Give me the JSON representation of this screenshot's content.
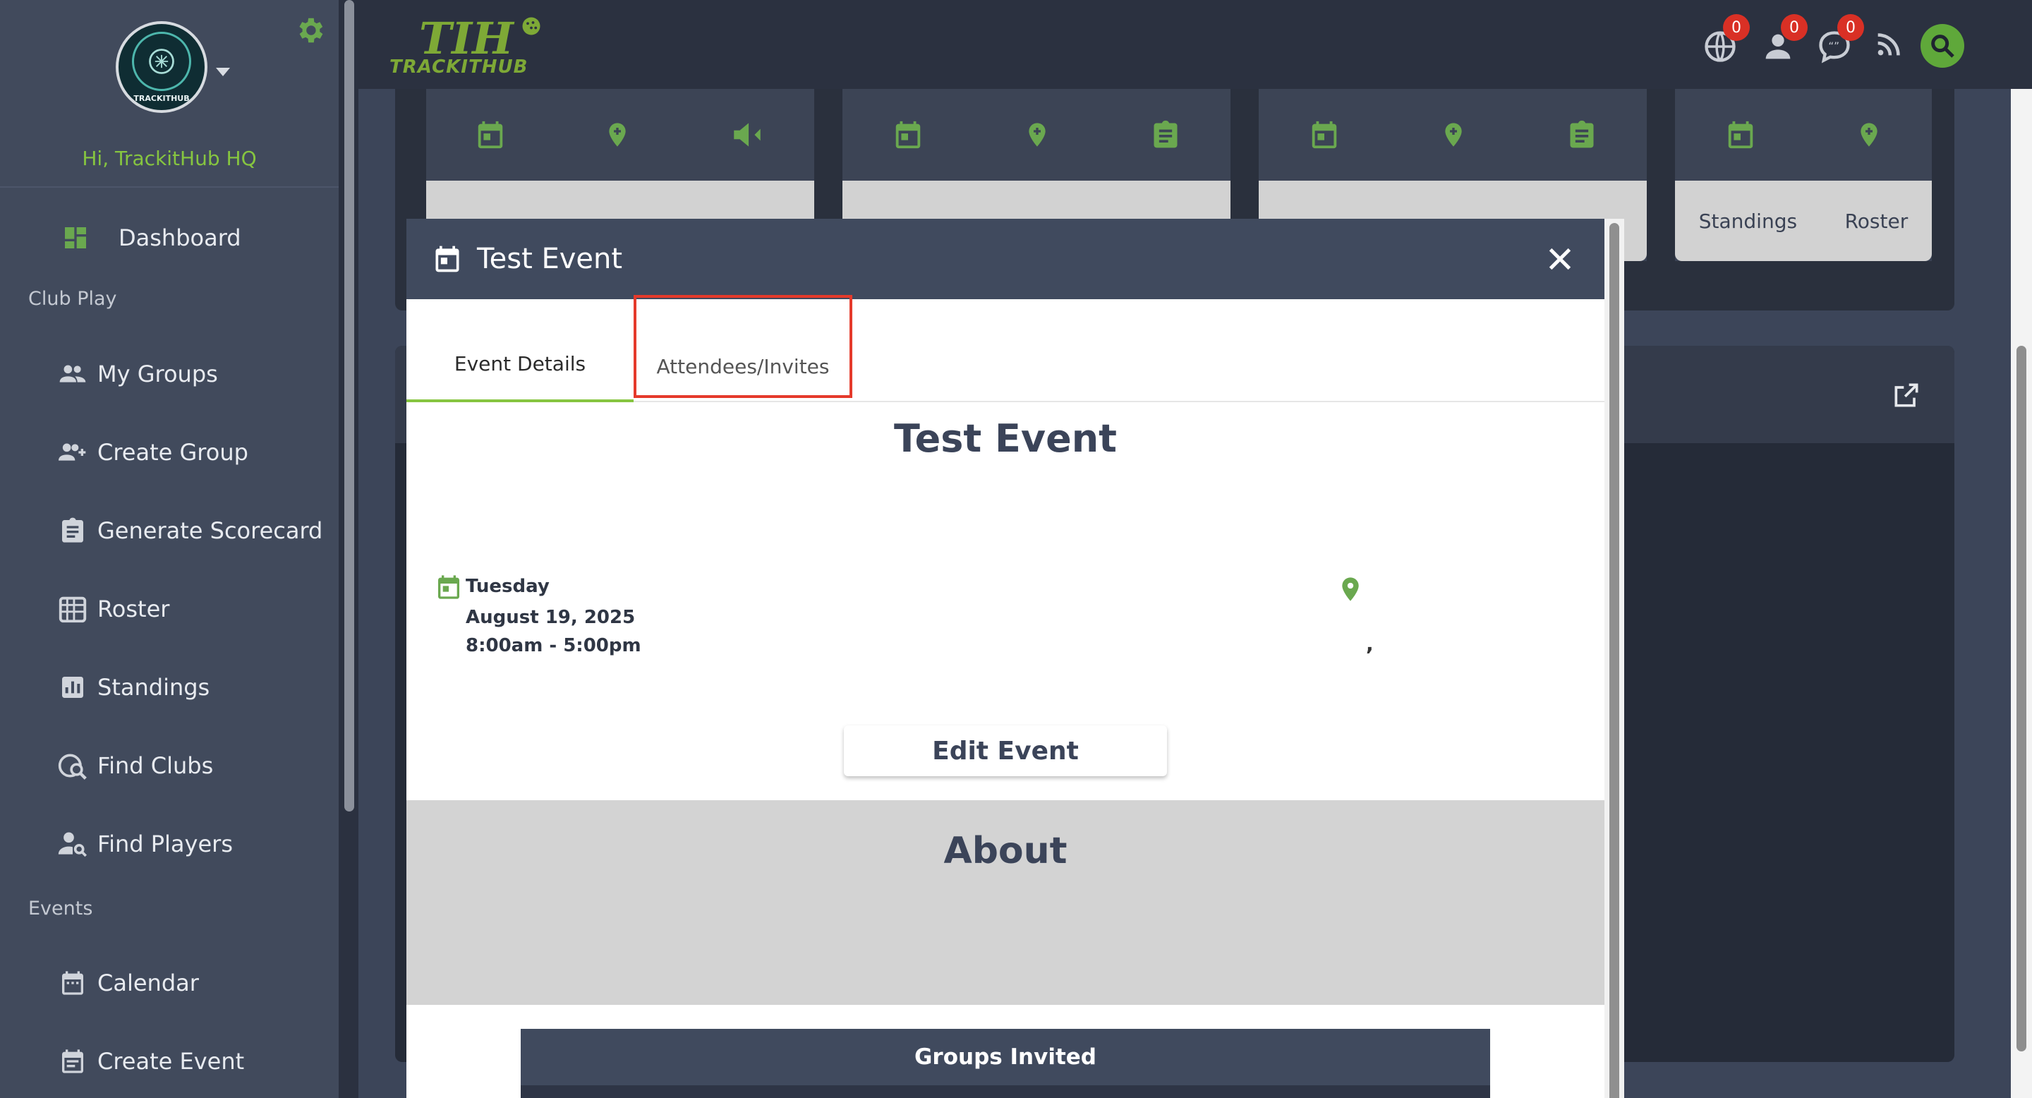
{
  "sidebar": {
    "greeting": "Hi, TrackitHub HQ",
    "avatar_text": "TRACKITHUB",
    "sections": {
      "club_play": "Club Play",
      "events": "Events"
    },
    "items": [
      {
        "label": "Dashboard",
        "icon": "dashboard-icon"
      },
      {
        "label": "My Groups",
        "icon": "groups-icon"
      },
      {
        "label": "Create Group",
        "icon": "add-group-icon"
      },
      {
        "label": "Generate Scorecard",
        "icon": "scorecard-icon"
      },
      {
        "label": "Roster",
        "icon": "roster-icon"
      },
      {
        "label": "Standings",
        "icon": "standings-icon"
      },
      {
        "label": "Find Clubs",
        "icon": "find-clubs-icon"
      },
      {
        "label": "Find Players",
        "icon": "find-players-icon"
      },
      {
        "label": "Calendar",
        "icon": "calendar-icon"
      },
      {
        "label": "Create Event",
        "icon": "create-event-icon"
      }
    ]
  },
  "header": {
    "logo_big": "TIH",
    "logo_small": "TRACKITHUB",
    "badges": {
      "globe": "0",
      "user": "0",
      "chat": "0"
    }
  },
  "background_cards": {
    "card4_labels": [
      "Standings",
      "Roster"
    ]
  },
  "modal": {
    "title": "Test Event",
    "tabs": [
      "Event Details",
      "Attendees/Invites"
    ],
    "event_title": "Test Event",
    "day": "Tuesday",
    "date": "August 19, 2025",
    "time": "8:00am - 5:00pm",
    "location": ",",
    "edit_label": "Edit Event",
    "about_label": "About",
    "groups_invited_label": "Groups Invited"
  },
  "colors": {
    "accent_green": "#86c540",
    "icon_green": "#6aa84f",
    "header_dark": "#2b3140",
    "modal_header": "#404a5e",
    "highlight_red": "#e53a2b"
  }
}
